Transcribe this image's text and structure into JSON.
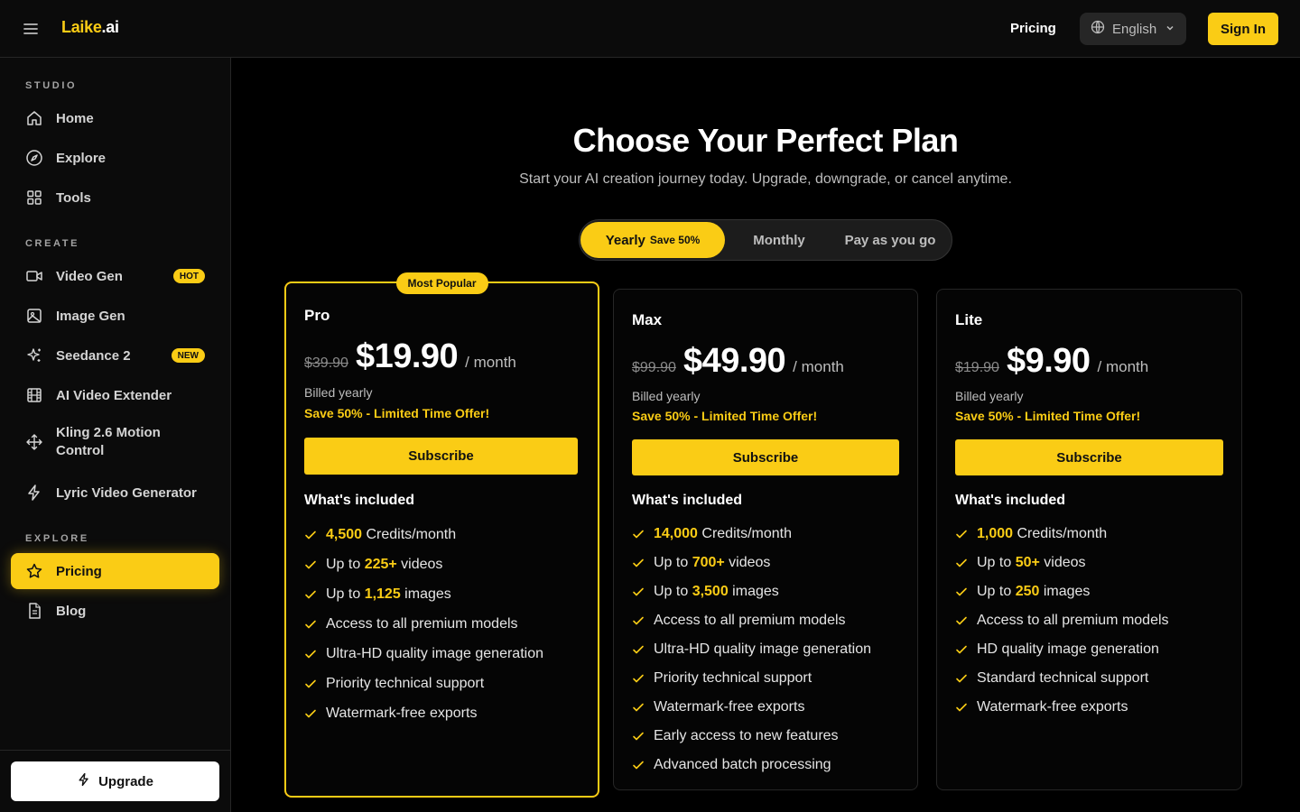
{
  "header": {
    "logo_main": "Laike",
    "logo_suffix": ".ai",
    "nav_pricing": "Pricing",
    "language": "English",
    "sign_in": "Sign In"
  },
  "sidebar": {
    "studio_title": "STUDIO",
    "studio_items": [
      {
        "label": "Home",
        "icon": "home-icon"
      },
      {
        "label": "Explore",
        "icon": "compass-icon"
      },
      {
        "label": "Tools",
        "icon": "grid-icon"
      }
    ],
    "create_title": "CREATE",
    "create_items": [
      {
        "label": "Video Gen",
        "icon": "video-icon",
        "badge": "HOT"
      },
      {
        "label": "Image Gen",
        "icon": "image-icon"
      },
      {
        "label": "Seedance 2",
        "icon": "sparkles-icon",
        "badge": "NEW"
      },
      {
        "label": "AI Video Extender",
        "icon": "film-icon"
      },
      {
        "label": "Kling 2.6 Motion Control",
        "icon": "move-icon"
      },
      {
        "label": "Lyric Video Generator",
        "icon": "zap-icon"
      }
    ],
    "explore_title": "EXPLORE",
    "explore_items": [
      {
        "label": "Pricing",
        "icon": "star-icon",
        "active": true
      },
      {
        "label": "Blog",
        "icon": "document-icon"
      }
    ],
    "upgrade": "Upgrade"
  },
  "main": {
    "title": "Choose Your Perfect Plan",
    "subtitle": "Start your AI creation journey today. Upgrade, downgrade, or cancel anytime.",
    "billing_toggle": {
      "yearly": "Yearly",
      "yearly_save": "Save 50%",
      "monthly": "Monthly",
      "payg": "Pay as you go",
      "selected": "Yearly"
    },
    "included_label": "What's included",
    "plans": [
      {
        "name": "Pro",
        "popular_badge": "Most Popular",
        "old_price": "$39.90",
        "price": "$19.90",
        "period": "/ month",
        "billed": "Billed yearly",
        "offer": "Save 50% - Limited Time Offer!",
        "cta": "Subscribe",
        "features": [
          {
            "hl": "4,500",
            "post": " Credits/month"
          },
          {
            "pre": "Up to ",
            "hl": "225+",
            "post": " videos"
          },
          {
            "pre": "Up to ",
            "hl": "1,125",
            "post": " images"
          },
          {
            "pre": "Access to all premium models"
          },
          {
            "pre": "Ultra-HD quality image generation"
          },
          {
            "pre": "Priority technical support"
          },
          {
            "pre": "Watermark-free exports"
          }
        ]
      },
      {
        "name": "Max",
        "old_price": "$99.90",
        "price": "$49.90",
        "period": "/ month",
        "billed": "Billed yearly",
        "offer": "Save 50% - Limited Time Offer!",
        "cta": "Subscribe",
        "features": [
          {
            "hl": "14,000",
            "post": " Credits/month"
          },
          {
            "pre": "Up to ",
            "hl": "700+",
            "post": " videos"
          },
          {
            "pre": "Up to ",
            "hl": "3,500",
            "post": " images"
          },
          {
            "pre": "Access to all premium models"
          },
          {
            "pre": "Ultra-HD quality image generation"
          },
          {
            "pre": "Priority technical support"
          },
          {
            "pre": "Watermark-free exports"
          },
          {
            "pre": "Early access to new features"
          },
          {
            "pre": "Advanced batch processing"
          }
        ]
      },
      {
        "name": "Lite",
        "old_price": "$19.90",
        "price": "$9.90",
        "period": "/ month",
        "billed": "Billed yearly",
        "offer": "Save 50% - Limited Time Offer!",
        "cta": "Subscribe",
        "features": [
          {
            "hl": "1,000",
            "post": " Credits/month"
          },
          {
            "pre": "Up to ",
            "hl": "50+",
            "post": " videos"
          },
          {
            "pre": "Up to ",
            "hl": "250",
            "post": " images"
          },
          {
            "pre": "Access to all premium models"
          },
          {
            "pre": "HD quality image generation"
          },
          {
            "pre": "Standard technical support"
          },
          {
            "pre": "Watermark-free exports"
          }
        ]
      }
    ]
  },
  "colors": {
    "accent": "#facc15",
    "background": "#000000",
    "panel": "#0b0b0b",
    "border": "#262626"
  }
}
